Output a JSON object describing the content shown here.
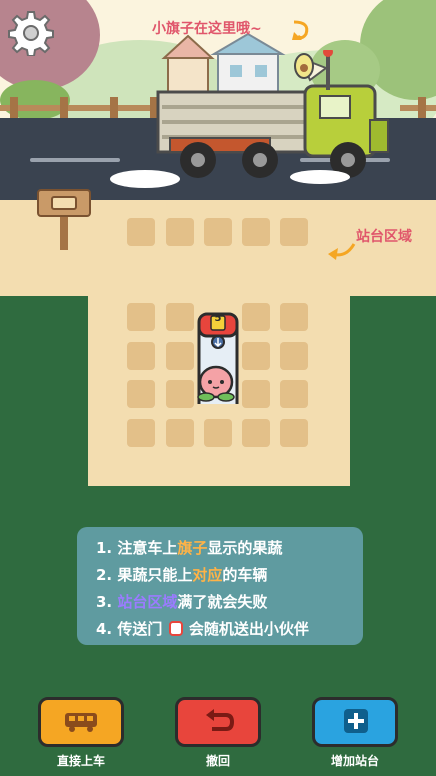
{
  "hud": {
    "flag_hint": "小旗子在这里哦~",
    "station_label": "站台区域",
    "car_badge_number": "5"
  },
  "rules": [
    {
      "prefix": "1. 注意车上",
      "highlight": "旗子",
      "suffix": "显示的果蔬"
    },
    {
      "prefix": "2. 果蔬只能上",
      "highlight": "对应",
      "suffix": "的车辆"
    },
    {
      "prefix": "3. ",
      "highlight": "站台区域",
      "suffix": "满了就会失败"
    },
    {
      "prefix": "4. 传送门",
      "highlight": "",
      "suffix": "会随机送出小伙伴"
    }
  ],
  "buttons": {
    "board": "直接上车",
    "undo": "撤回",
    "add_station": "增加站台"
  },
  "colors": {
    "board_button": "#f5a623",
    "undo_button": "#e8453c",
    "add_button": "#2aa3e0",
    "grass": "#2f6b3f",
    "sand": "#f3ddb0"
  },
  "icons": {
    "settings": "gear-icon",
    "bus": "bus-icon",
    "undo": "undo-arrow-icon",
    "add": "plus-icon",
    "portal": "portal-icon"
  }
}
